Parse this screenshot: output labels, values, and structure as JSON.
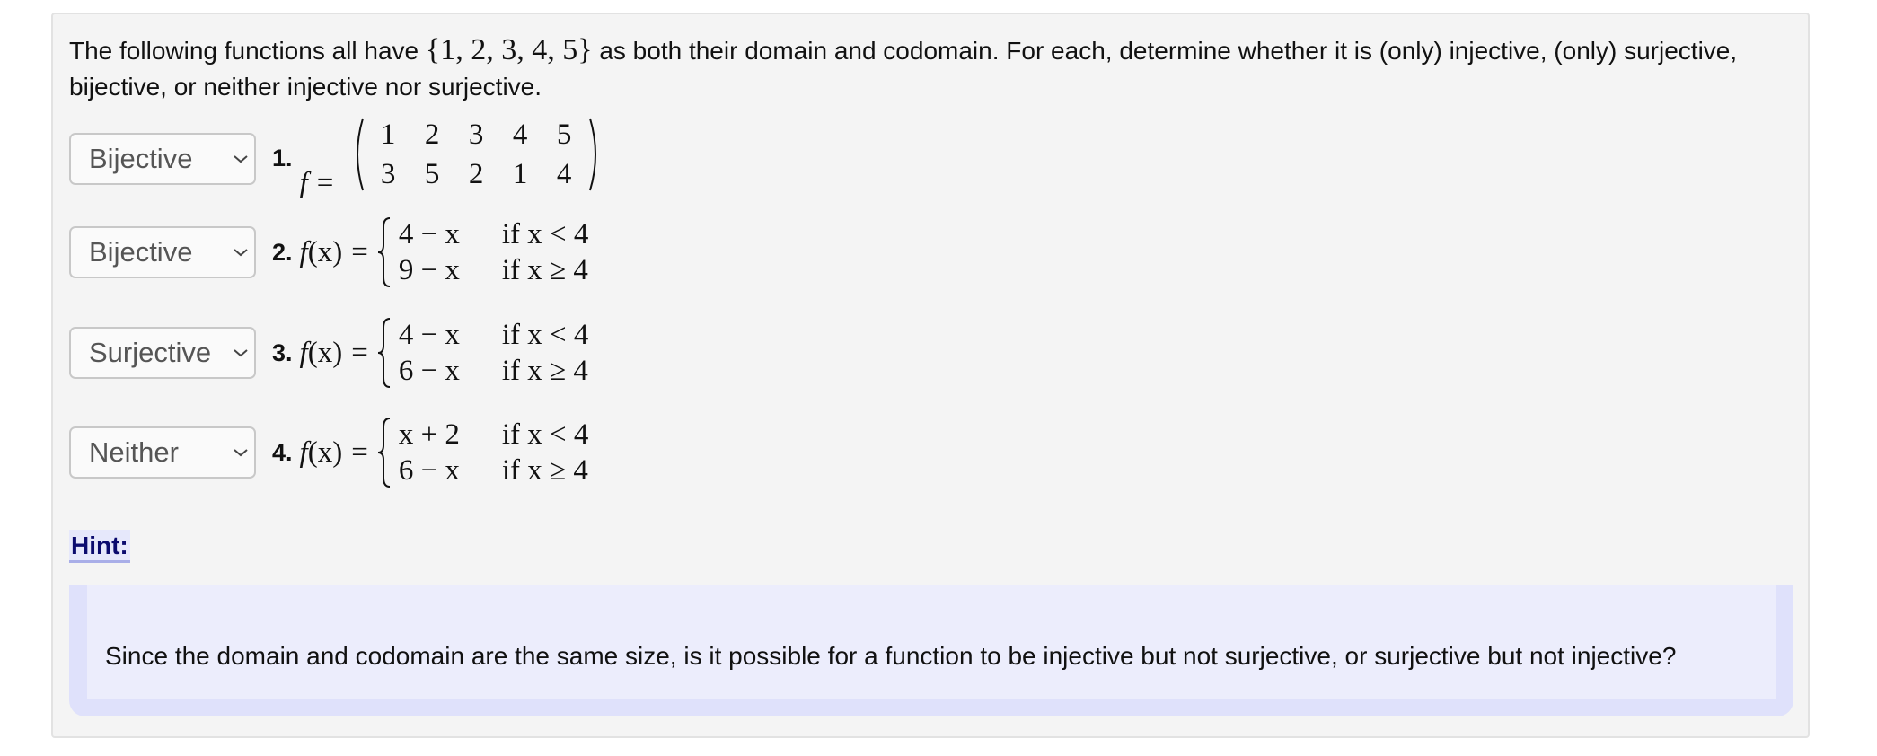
{
  "intro": {
    "prefix": "The following functions all have ",
    "set": "{1, 2, 3, 4, 5}",
    "suffix": " as both their domain and codomain. For each, determine whether it is (only) injective, (only) surjective, bijective, or neither injective nor surjective."
  },
  "icons": {
    "dropdown": "chevron-down-icon"
  },
  "questions": [
    {
      "selected": "Bijective",
      "number": "1.",
      "lhs_fn": "f",
      "equals": "=",
      "matrix": {
        "top": [
          "1",
          "2",
          "3",
          "4",
          "5"
        ],
        "bottom": [
          "3",
          "5",
          "2",
          "1",
          "4"
        ]
      }
    },
    {
      "selected": "Bijective",
      "number": "2.",
      "lhs_fn": "f",
      "lhs_arg": "(x)",
      "equals": "=",
      "cases": [
        {
          "expr": "4 − x",
          "cond": "if x < 4"
        },
        {
          "expr": "9 − x",
          "cond": "if x ≥ 4"
        }
      ]
    },
    {
      "selected": "Surjective",
      "number": "3.",
      "lhs_fn": "f",
      "lhs_arg": "(x)",
      "equals": "=",
      "cases": [
        {
          "expr": "4 − x",
          "cond": "if x < 4"
        },
        {
          "expr": "6 − x",
          "cond": "if x ≥ 4"
        }
      ]
    },
    {
      "selected": "Neither",
      "number": "4.",
      "lhs_fn": "f",
      "lhs_arg": "(x)",
      "equals": "=",
      "cases": [
        {
          "expr": "x + 2",
          "cond": "if x < 4"
        },
        {
          "expr": "6 − x",
          "cond": "if x ≥ 4"
        }
      ]
    }
  ],
  "hint": {
    "label": "Hint:",
    "text": "Since the domain and codomain are the same size, is it possible for a function to be injective but not surjective, or surjective but not injective?"
  }
}
